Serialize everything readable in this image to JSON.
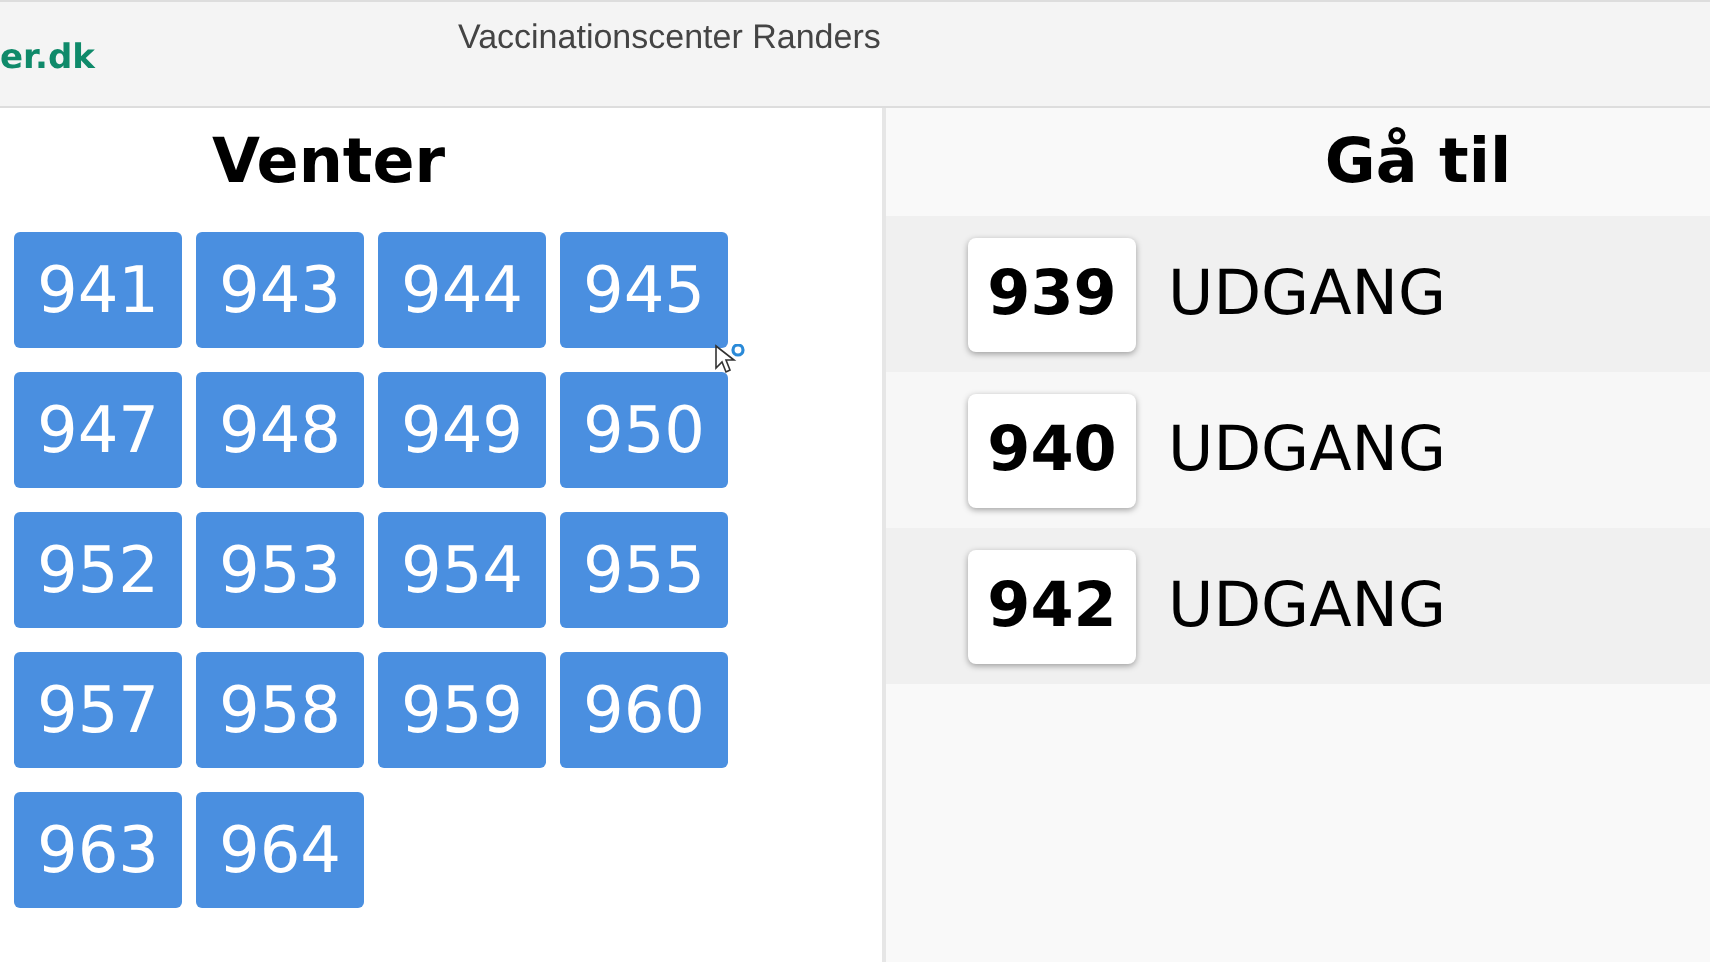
{
  "header": {
    "logo": "er.dk",
    "title": "Vaccinationscenter Randers"
  },
  "waiting": {
    "heading": "Venter",
    "numbers": [
      "941",
      "943",
      "944",
      "945",
      "947",
      "948",
      "949",
      "950",
      "952",
      "953",
      "954",
      "955",
      "957",
      "958",
      "959",
      "960",
      "963",
      "964"
    ]
  },
  "called": {
    "heading": "Gå til",
    "rows": [
      {
        "number": "939",
        "destination": "UDGANG"
      },
      {
        "number": "940",
        "destination": "UDGANG"
      },
      {
        "number": "942",
        "destination": "UDGANG"
      }
    ]
  }
}
